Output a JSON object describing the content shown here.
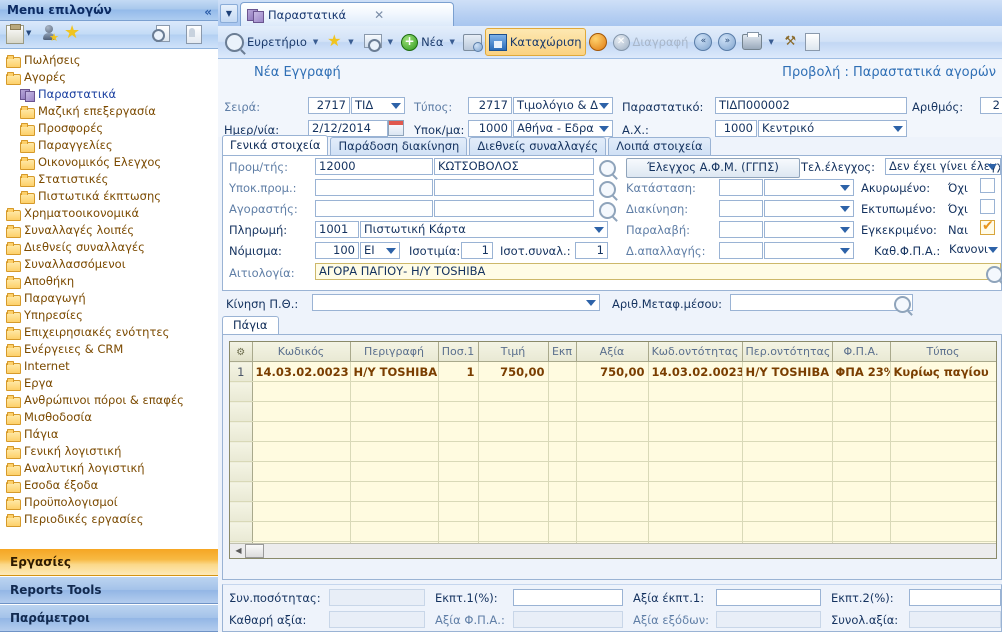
{
  "sidebar": {
    "title": "Menu επιλογών",
    "collapse_icon": "chevron-left-double-icon",
    "toolbar_icons": [
      "clipboard-icon",
      "dropdown-arrow-icon",
      "user-star-icon",
      "star-icon",
      "search-preview-icon",
      "document-icon"
    ],
    "tree": [
      {
        "label": "Πωλήσεις",
        "level": 1,
        "icon": "folder",
        "selected": false
      },
      {
        "label": "Αγορές",
        "level": 1,
        "icon": "folder",
        "selected": false
      },
      {
        "label": "Παραστατικά",
        "level": 2,
        "icon": "cubes",
        "selected": true
      },
      {
        "label": "Μαζική επεξεργασία",
        "level": 2,
        "icon": "folder",
        "selected": false
      },
      {
        "label": "Προσφορές",
        "level": 2,
        "icon": "folder",
        "selected": false
      },
      {
        "label": "Παραγγελίες",
        "level": 2,
        "icon": "folder",
        "selected": false
      },
      {
        "label": "Οικονομικός Ελεγχος",
        "level": 2,
        "icon": "folder",
        "selected": false
      },
      {
        "label": "Στατιστικές",
        "level": 2,
        "icon": "folder",
        "selected": false
      },
      {
        "label": "Πιστωτικά έκπτωσης",
        "level": 2,
        "icon": "folder",
        "selected": false
      },
      {
        "label": "Χρηματοοικονομικά",
        "level": 1,
        "icon": "folder",
        "selected": false
      },
      {
        "label": "Συναλλαγές λοιπές",
        "level": 1,
        "icon": "folder",
        "selected": false
      },
      {
        "label": "Διεθνείς συναλλαγές",
        "level": 1,
        "icon": "folder",
        "selected": false
      },
      {
        "label": "Συναλλασσόμενοι",
        "level": 1,
        "icon": "folder",
        "selected": false
      },
      {
        "label": "Αποθήκη",
        "level": 1,
        "icon": "folder",
        "selected": false
      },
      {
        "label": "Παραγωγή",
        "level": 1,
        "icon": "folder",
        "selected": false
      },
      {
        "label": "Υπηρεσίες",
        "level": 1,
        "icon": "folder",
        "selected": false
      },
      {
        "label": "Επιχειρησιακές ενότητες",
        "level": 1,
        "icon": "folder",
        "selected": false
      },
      {
        "label": "Ενέργειες & CRM",
        "level": 1,
        "icon": "folder",
        "selected": false
      },
      {
        "label": "Internet",
        "level": 1,
        "icon": "folder",
        "selected": false
      },
      {
        "label": "Εργα",
        "level": 1,
        "icon": "folder",
        "selected": false
      },
      {
        "label": "Ανθρώπινοι πόροι & επαφές",
        "level": 1,
        "icon": "folder",
        "selected": false
      },
      {
        "label": "Μισθοδοσία",
        "level": 1,
        "icon": "folder",
        "selected": false
      },
      {
        "label": "Πάγια",
        "level": 1,
        "icon": "folder",
        "selected": false
      },
      {
        "label": "Γενική λογιστική",
        "level": 1,
        "icon": "folder",
        "selected": false
      },
      {
        "label": "Αναλυτική λογιστική",
        "level": 1,
        "icon": "folder",
        "selected": false
      },
      {
        "label": "Εσοδα έξοδα",
        "level": 1,
        "icon": "folder",
        "selected": false
      },
      {
        "label": "Προϋπολογισμοί",
        "level": 1,
        "icon": "folder",
        "selected": false
      },
      {
        "label": "Περιοδικές εργασίες",
        "level": 1,
        "icon": "folder",
        "selected": false
      }
    ],
    "bottom_bars": [
      {
        "label": "Εργασίες",
        "active": true
      },
      {
        "label": "Reports Tools",
        "active": false
      },
      {
        "label": "Παράμετροι",
        "active": false
      }
    ]
  },
  "document_tab": {
    "label": "Παραστατικά",
    "close_label": "✕",
    "icon": "cubes-icon"
  },
  "toolbar": {
    "index_label": "Ευρετήριο",
    "new_label": "Νέα",
    "save_label": "Καταχώριση",
    "delete_label": "Διαγραφή"
  },
  "header": {
    "new_record": "Νέα Εγγραφή",
    "view_title": "Προβολή : Παραστατικά αγορών",
    "seira_label": "Σειρά:",
    "seira_code": "2717",
    "seira_value": "ΤΙΔ",
    "date_label": "Ημερ/νία:",
    "date_value": "2/12/2014",
    "type_label": "Τύπος:",
    "type_code": "2717",
    "type_value": "Τιμολόγιο & Δ",
    "branch_label": "Υποκ/μα:",
    "branch_code": "1000",
    "branch_value": "Αθήνα - Εδρα",
    "doc_label": "Παραστατικό:",
    "doc_value": "ΤΙΔΠ000002",
    "number_label": "Αριθμός:",
    "number_value": "2",
    "ax_label": "Α.Χ.:",
    "ax_code": "1000",
    "ax_value": "Κεντρικό"
  },
  "form_tabs": [
    {
      "label": "Γενικά στοιχεία",
      "active": true
    },
    {
      "label": "Παράδοση διακίνηση",
      "active": false
    },
    {
      "label": "Διεθνείς συναλλαγές",
      "active": false
    },
    {
      "label": "Λοιπά στοιχεία",
      "active": false
    }
  ],
  "form": {
    "supplier_label": "Προμ/τής:",
    "supplier_code": "12000",
    "supplier_name": "ΚΩΤΣΟΒΟΛΟΣ",
    "sub_supplier_label": "Υποκ.προμ.:",
    "sub_supplier_code": "",
    "sub_supplier_name": "",
    "buyer_label": "Αγοραστής:",
    "buyer_code": "",
    "buyer_name": "",
    "payment_label": "Πληρωμή:",
    "payment_code": "1001",
    "payment_value": "Πιστωτική Κάρτα",
    "currency_label": "Νόμισμα:",
    "currency_code": "100",
    "currency_value": "EI",
    "parity_label": "Ισοτιμία:",
    "parity_value": "1",
    "parity2_label": "Ισοτ.συναλ.:",
    "parity2_value": "1",
    "reason_label": "Αιτιολογία:",
    "reason_value": "ΑΓΟΡΑ ΠΑΓΙΟΥ- Η/Υ TOSHIBA",
    "vat_check_button": "Έλεγχος Α.Φ.Μ. (ΓΓΠΣ)",
    "last_check_label": "Τελ.έλεγχος:",
    "last_check_value": "Δεν έχει γίνει έλεγχ",
    "status_label": "Κατάσταση:",
    "status_code": "",
    "status_value": "",
    "transport_label": "Διακίνηση:",
    "transport_code": "",
    "transport_value": "",
    "receipt_label": "Παραλαβή:",
    "receipt_code": "",
    "receipt_value": "",
    "exempt_label": "Δ.απαλλαγής:",
    "exempt_code": "",
    "exempt_value": "",
    "cancelled_label": "Ακυρωμένο:",
    "cancelled_value": "Όχι",
    "cancelled_checked": false,
    "printed_label": "Εκτυπωμένο:",
    "printed_value": "Όχι",
    "printed_checked": false,
    "approved_label": "Εγκεκριμένο:",
    "approved_value": "Ναι",
    "approved_checked": true,
    "vat_regime_label": "Καθ.Φ.Π.Α.:",
    "vat_regime_value": "Κανονι"
  },
  "mid": {
    "movement_label": "Κίνηση Π.Θ.:",
    "movement_value": "",
    "transport_num_label": "Αριθ.Μεταφ.μέσου:",
    "transport_num_value": ""
  },
  "grid_tab": {
    "label": "Πάγια"
  },
  "grid": {
    "columns": [
      "Κωδικός",
      "Περιγραφή",
      "Ποσ.1",
      "Τιμή",
      "Εκπ",
      "Αξία",
      "Κωδ.οντότητας",
      "Περ.οντότητας",
      "Φ.Π.Α.",
      "Τύπος"
    ],
    "rows": [
      {
        "index": "1",
        "code": "14.03.02.0023",
        "description": "Η/Υ TOSHIBA",
        "qty": "1",
        "price": "750,00",
        "discount": "",
        "value": "750,00",
        "entity_code": "14.03.02.0023",
        "entity_desc": "Η/Υ TOSHIBA",
        "vat": "ΦΠΑ 23%",
        "type": "Κυρίως παγίου"
      }
    ],
    "empty_rows": 9
  },
  "footer": {
    "sum_qty_label": "Συν.ποσότητας:",
    "sum_qty_value": "",
    "net_value_label": "Καθαρή αξία:",
    "net_value_value": "",
    "disc1_label": "Εκπτ.1(%):",
    "disc1_value": "",
    "vat_value_label": "Αξία Φ.Π.Α.:",
    "vat_value_value": "",
    "disc1_amt_label": "Αξία έκπτ.1:",
    "disc1_amt_value": "",
    "expenses_label": "Αξία εξόδων:",
    "expenses_value": "",
    "disc2_label": "Εκπτ.2(%):",
    "disc2_value": "",
    "total_label": "Συνολ.αξία:",
    "total_value": ""
  },
  "colors": {
    "accent_blue": "#2f6fb5",
    "sidebar_text": "#7b4a00",
    "grid_text": "#7a3e00",
    "grid_bg": "#fffce6",
    "active_bar": "#f6a623"
  }
}
